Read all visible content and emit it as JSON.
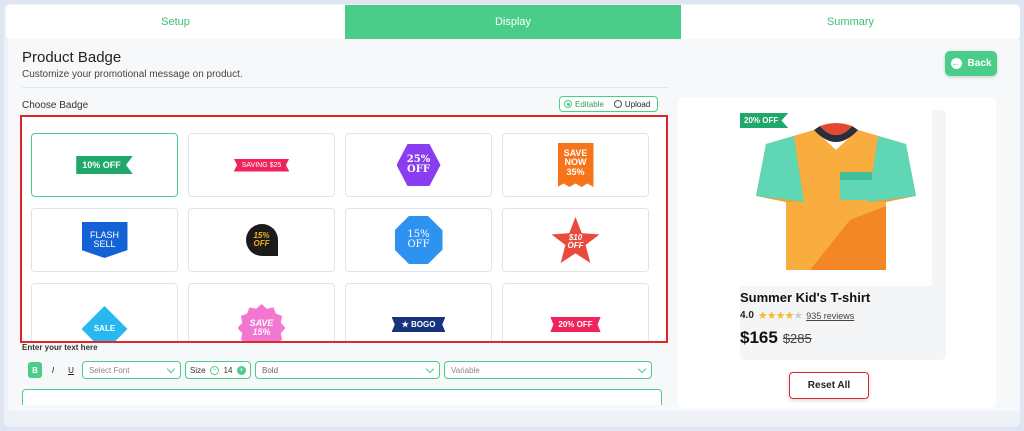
{
  "tabs": [
    {
      "label": "Setup",
      "active": false
    },
    {
      "label": "Display",
      "active": true
    },
    {
      "label": "Summary",
      "active": false
    }
  ],
  "header": {
    "title": "Product Badge",
    "subtitle": "Customize your promotional message on product.",
    "back_label": "Back"
  },
  "choose": {
    "label": "Choose Badge",
    "modes": [
      {
        "label": "Editable",
        "selected": true
      },
      {
        "label": "Upload",
        "selected": false
      }
    ]
  },
  "badges": [
    {
      "text": "10% OFF",
      "color": "#1fa86a"
    },
    {
      "text": "SAVING $25",
      "color": "#f0245a"
    },
    {
      "line1": "25%",
      "line2": "OFF",
      "color": "#8a3df0"
    },
    {
      "line1": "SAVE",
      "line2": "NOW",
      "line3": "35%",
      "color": "#f6741a"
    },
    {
      "line1": "FLASH",
      "line2": "SELL",
      "color": "#1463d6"
    },
    {
      "line1": "15%",
      "line2": "OFF",
      "color": "#1b1b1b"
    },
    {
      "line1": "15%",
      "line2": "OFF",
      "color": "#2e93f0"
    },
    {
      "line1": "$10",
      "line2": "OFF",
      "color": "#e84b3c"
    },
    {
      "text": "SALE",
      "color": "#28b8f0"
    },
    {
      "line1": "SAVE",
      "line2": "15%",
      "color": "#f277d0"
    },
    {
      "text": "BOGO",
      "color": "#17337d"
    },
    {
      "text": "20% OFF",
      "color": "#f0245a"
    }
  ],
  "text_editor": {
    "label": "Enter your text here",
    "format_bold": "B",
    "format_italic": "I",
    "format_underline": "U",
    "font_placeholder": "Select Font",
    "size_label": "Size",
    "size_value": "14",
    "weight_value": "Bold",
    "variable_placeholder": "Variable"
  },
  "preview": {
    "badge_text": "20% OFF",
    "product_name": "Summer Kid's T-shirt",
    "rating": "4.0",
    "reviews": "935 reviews",
    "price": "$165",
    "old_price": "$285"
  },
  "reset_label": "Reset All",
  "colors": {
    "accent": "#49cd88",
    "highlight": "#e0262d"
  }
}
